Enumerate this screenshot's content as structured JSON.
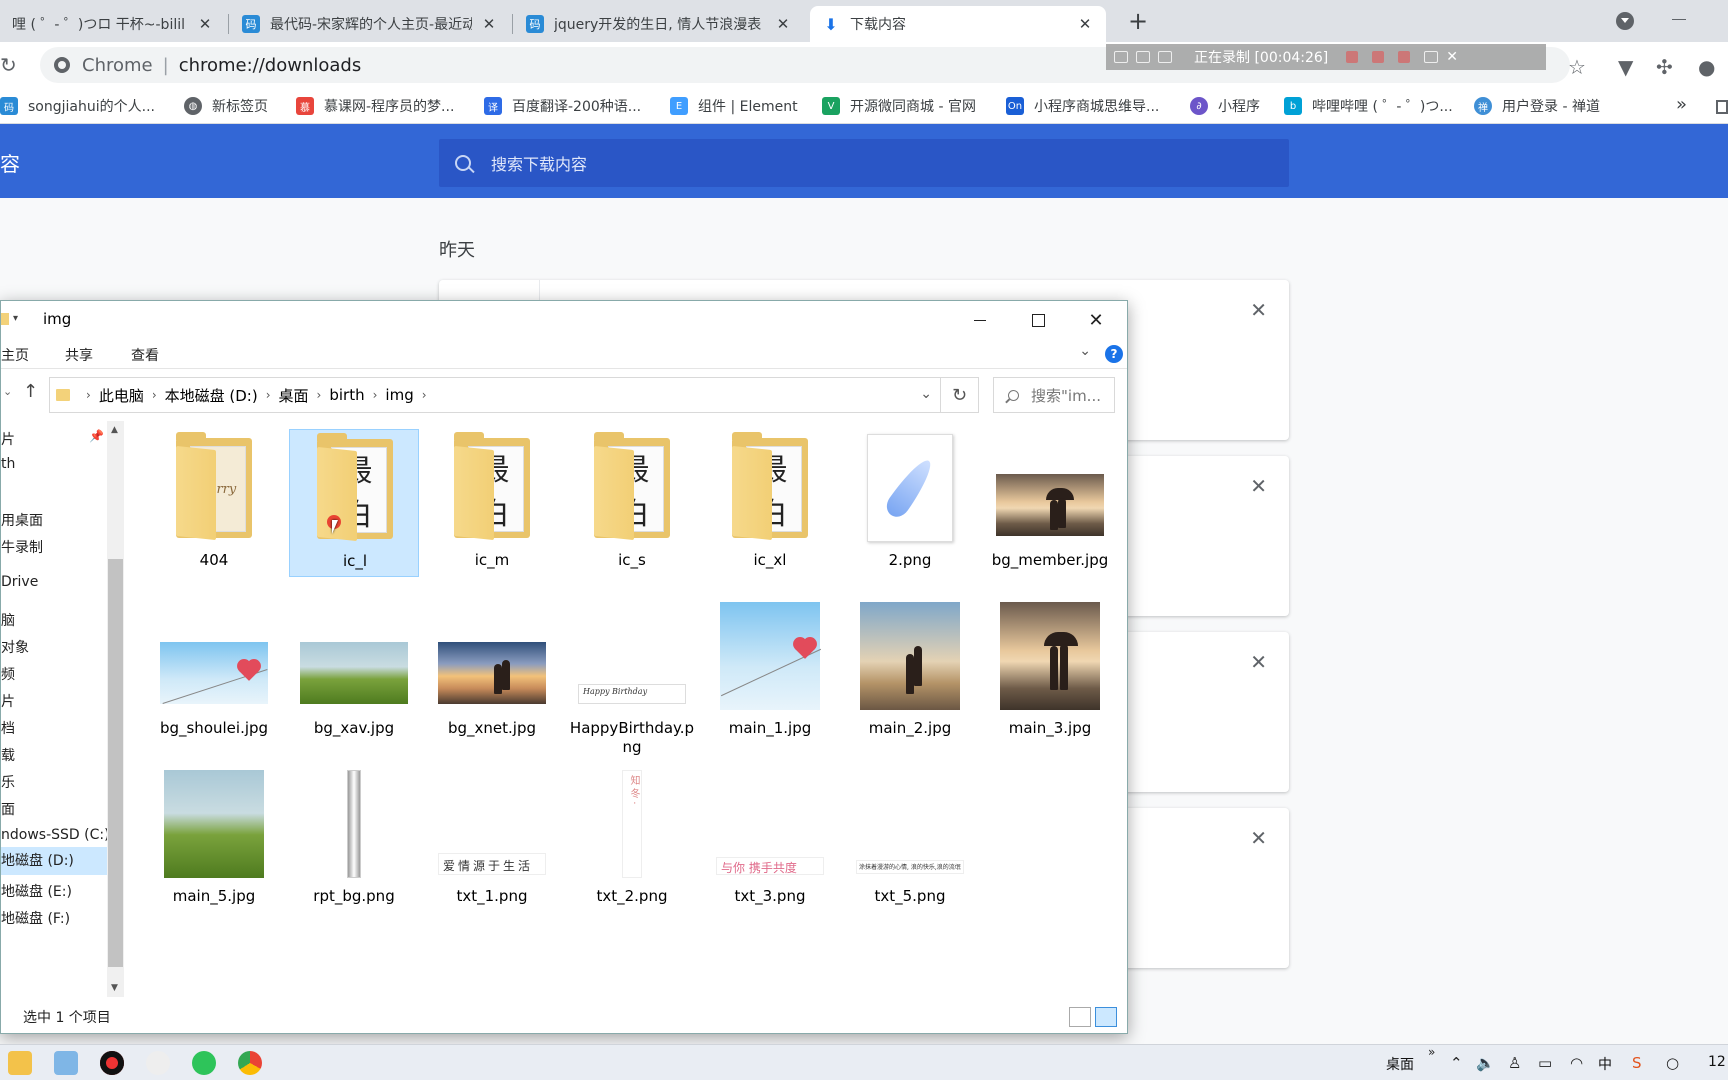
{
  "browser": {
    "tabs": [
      {
        "title": "哩 ( ゜- ゜)つロ 干杯~-bilil",
        "icon": "bilibili-icon",
        "color": "#00a1d6"
      },
      {
        "title": "最代码-宋家辉的个人主页-最近动",
        "icon": "zuidaima-icon",
        "color": "#2a8bd6"
      },
      {
        "title": "jquery开发的生日, 情人节浪漫表",
        "icon": "zuidaima-icon",
        "color": "#2a8bd6"
      },
      {
        "title": "下载内容",
        "icon": "download-icon",
        "color": "#1a73e8",
        "active": true
      }
    ],
    "new_tab": "+",
    "address": {
      "site": "Chrome",
      "separator": "|",
      "url": "chrome://downloads"
    },
    "recorder": {
      "text": "正在录制 [00:04:26]"
    },
    "bookmarks": [
      {
        "label": "songjiahui的个人...",
        "color": "#2a8bd6",
        "glyph": "码"
      },
      {
        "label": "新标签页",
        "color": "#5f6368",
        "glyph": "◍"
      },
      {
        "label": "慕课网-程序员的梦...",
        "color": "#e8453c",
        "glyph": "慕"
      },
      {
        "label": "百度翻译-200种语...",
        "color": "#2e6be6",
        "glyph": "译"
      },
      {
        "label": "组件 | Element",
        "color": "#409eff",
        "glyph": "E"
      },
      {
        "label": "开源微同商城 - 官网",
        "color": "#1aa260",
        "glyph": "V"
      },
      {
        "label": "小程序商城思维导...",
        "color": "#1a5fd6",
        "glyph": "On"
      },
      {
        "label": "小程序",
        "color": "#6c55c9",
        "glyph": "∂"
      },
      {
        "label": "哔哩哔哩 ( ゜- ゜)つ...",
        "color": "#00a1d6",
        "glyph": "b"
      },
      {
        "label": "用户登录 - 禅道",
        "color": "#3f8fd6",
        "glyph": "禅"
      }
    ],
    "bookmarks_more": "»"
  },
  "downloads": {
    "title": "容",
    "search_placeholder": "搜索下载内容",
    "day_label": "昨天",
    "card_close": "✕"
  },
  "explorer": {
    "title": "img",
    "ribbon_tabs": [
      "主页",
      "共享",
      "查看"
    ],
    "breadcrumb": [
      "此电脑",
      "本地磁盘 (D:)",
      "桌面",
      "birth",
      "img"
    ],
    "search_placeholder": "搜索\"im...",
    "nav_items": [
      {
        "label": "片"
      },
      {
        "label": "th"
      },
      {
        "label": "用桌面"
      },
      {
        "label": "牛录制"
      },
      {
        "label": "Drive"
      },
      {
        "label": "脑"
      },
      {
        "label": " 对象"
      },
      {
        "label": "频"
      },
      {
        "label": "片"
      },
      {
        "label": "档"
      },
      {
        "label": "载"
      },
      {
        "label": "乐"
      },
      {
        "label": "面"
      },
      {
        "label": "ndows-SSD (C:)"
      },
      {
        "label": "地磁盘 (D:)",
        "selected": true
      },
      {
        "label": "地磁盘 (E:)"
      },
      {
        "label": "地磁盘 (F:)"
      }
    ],
    "files": [
      {
        "name": "404",
        "kind": "folder",
        "paper": "Sorry"
      },
      {
        "name": "ic_l",
        "kind": "folder",
        "paper": "最 白",
        "selected": true
      },
      {
        "name": "ic_m",
        "kind": "folder",
        "paper": "最 白"
      },
      {
        "name": "ic_s",
        "kind": "folder",
        "paper": "最 白"
      },
      {
        "name": "ic_xl",
        "kind": "folder",
        "paper": "最 白"
      },
      {
        "name": "2.png",
        "kind": "feather"
      },
      {
        "name": "bg_member.jpg",
        "kind": "dusk"
      },
      {
        "name": "bg_shoulei.jpg",
        "kind": "sky-heart"
      },
      {
        "name": "bg_xav.jpg",
        "kind": "grass"
      },
      {
        "name": "bg_xnet.jpg",
        "kind": "sunset"
      },
      {
        "name": "HappyBirthday.png",
        "kind": "card",
        "caption": "Happy Birthday"
      },
      {
        "name": "main_1.jpg",
        "kind": "sky-heart-big"
      },
      {
        "name": "main_2.jpg",
        "kind": "beach"
      },
      {
        "name": "main_3.jpg",
        "kind": "dusk-big"
      },
      {
        "name": "main_5.jpg",
        "kind": "grass-big"
      },
      {
        "name": "rpt_bg.png",
        "kind": "strip"
      },
      {
        "name": "txt_1.png",
        "kind": "text",
        "caption": "爱情源于生活"
      },
      {
        "name": "txt_2.png",
        "kind": "vtext",
        "caption": "知 冬 ·"
      },
      {
        "name": "txt_3.png",
        "kind": "text",
        "caption": "与你 携手共度"
      },
      {
        "name": "txt_5.png",
        "kind": "text",
        "caption": "涂抹着漫游的心情,  浪的快乐,浪的流氓"
      }
    ],
    "status": "选中 1 个项目"
  },
  "taskbar": {
    "desktop_label": "桌面",
    "ime": "中",
    "clock": "12"
  }
}
